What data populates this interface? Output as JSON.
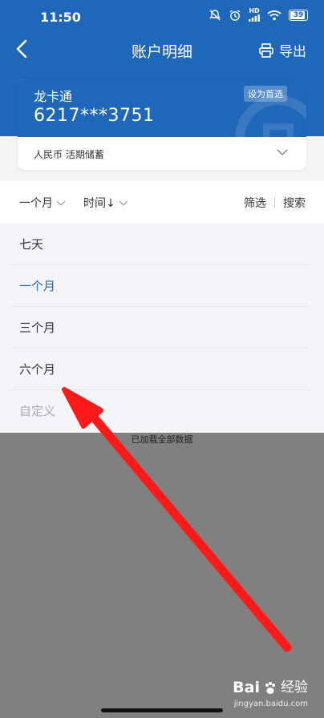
{
  "status_bar": {
    "time": "11:50",
    "network": "HD",
    "battery": "39"
  },
  "nav": {
    "back_icon": "back-arrow-icon",
    "title": "账户明细",
    "export_label": "导出"
  },
  "card": {
    "name": "龙卡通",
    "number": "6217***3751",
    "set_default_label": "设为首选",
    "account_type": "人民币 活期储蓄"
  },
  "filter_bar": {
    "period_label": "一个月",
    "sort_label": "时间↓",
    "filter_label": "筛选",
    "search_label": "搜索"
  },
  "dropdown": {
    "items": [
      "七天",
      "一个月",
      "三个月",
      "六个月",
      "自定义"
    ],
    "selected": "一个月"
  },
  "footer": {
    "loaded_text": "已加载全部数据"
  },
  "watermark": {
    "brand": "Bai",
    "brand_suffix": "经验",
    "site": "jingyan.baidu.com"
  },
  "colors": {
    "primary": "#1f67b9",
    "overlay": "#808080",
    "arrow": "#ff1a1a"
  }
}
